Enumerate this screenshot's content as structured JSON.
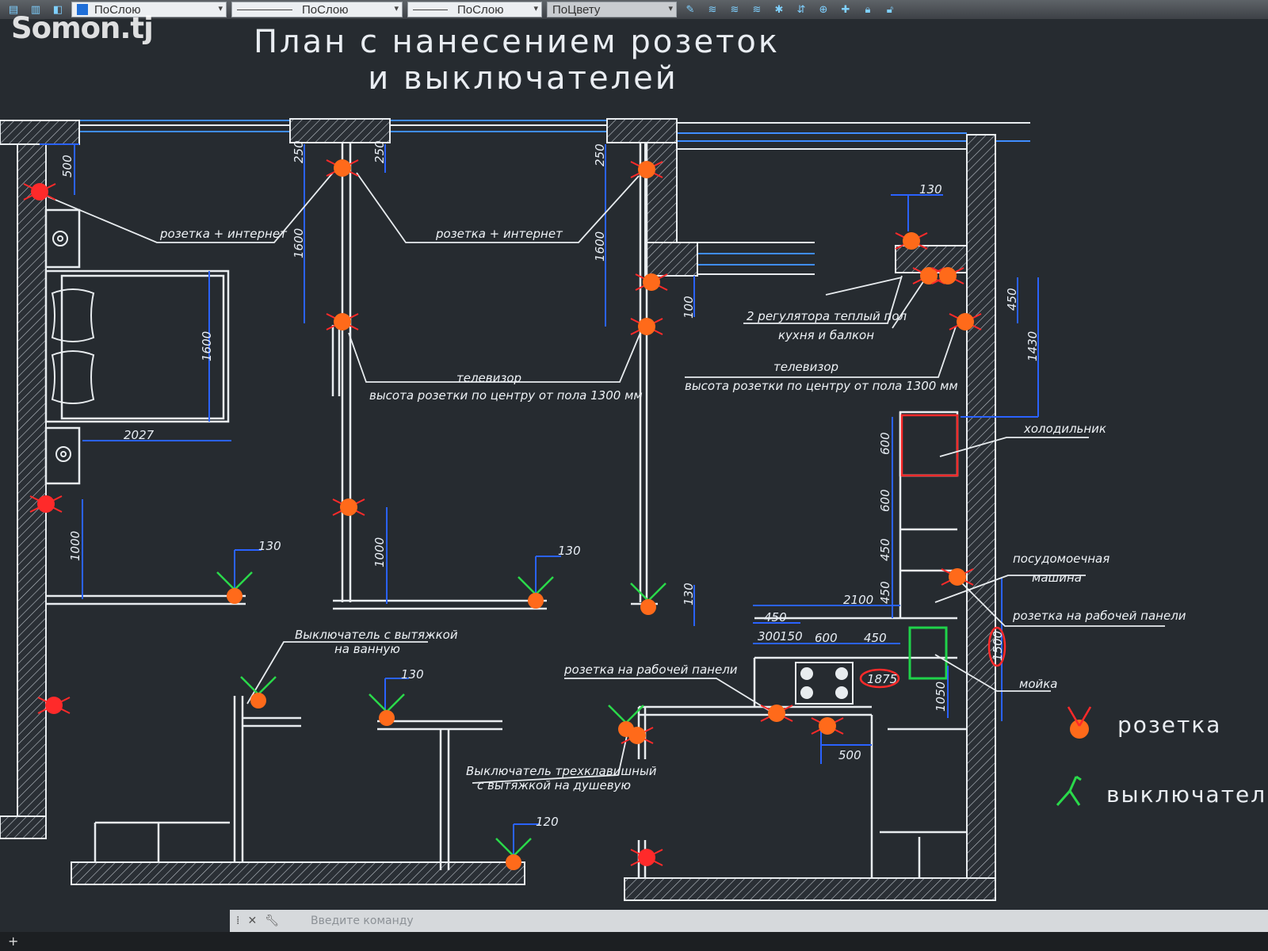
{
  "watermark": "Somon.tj",
  "toolbar": {
    "layer_select": "ПоСлою",
    "linetype_select": "ПоСлою",
    "lineweight_select": "ПоСлою",
    "color_select": "ПоЦвету",
    "layer_swatch_color": "#1f6fd8"
  },
  "drawing": {
    "title_line1": "План с нанесением розеток",
    "title_line2": "и выключателей",
    "labels": {
      "socket_internet_1": "розетка + интернет",
      "socket_internet_2": "розетка + интернет",
      "tv_1": "телевизор",
      "tv_height_1": "высота розетки по центру от пола 1300 мм",
      "tv_2": "телевизор",
      "tv_height_2": "высота розетки по центру от пола 1300 мм",
      "floor_regulators_1": "2 регулятора теплый пол",
      "floor_regulators_2": "кухня и балкон",
      "fridge": "холодильник",
      "dishwasher_1": "посудомоечная",
      "dishwasher_2": "машина",
      "work_panel_socket_right": "розетка на рабочей панели",
      "work_panel_socket_left": "розетка на рабочей панели",
      "sink": "мойка",
      "bath_switch_1": "Выключатель с вытяжкой",
      "bath_switch_2": "на ванную",
      "triple_switch_1": "Выключатель трехклавишный",
      "triple_switch_2": "с вытяжкой на душевую"
    },
    "dimensions": {
      "d500_top": "500",
      "d250_a": "250",
      "d250_b": "250",
      "d250_c": "250",
      "d1600_a": "1600",
      "d1600_b": "1600",
      "d1600_bed": "1600",
      "d2027": "2027",
      "d100": "100",
      "d130_top": "130",
      "d450_right": "450",
      "d1430": "1430",
      "d600_a": "600",
      "d600_b": "600",
      "d450_a": "450",
      "d450_b": "450",
      "d2100": "2100",
      "d450_c": "450",
      "d300": "300",
      "d150": "150",
      "d600_c": "600",
      "d450_d": "450",
      "d1875": "1875",
      "d1050": "1050",
      "d1500": "1500",
      "d500_bottom": "500",
      "d1000_a": "1000",
      "d1000_b": "1000",
      "d130_a": "130",
      "d130_b": "130",
      "d130_c": "130",
      "d130_d": "130",
      "d120": "120"
    },
    "legend": {
      "socket": "розетка",
      "switch": "выключател"
    },
    "colors": {
      "wall": "#e8ecef",
      "dimension": "#1f5fff",
      "socket_fill": "#ff6a1a",
      "socket_red": "#ff2a2a",
      "switch_green": "#2ad94a",
      "fridge_outline": "#ff2a2a",
      "sink_outline": "#1fd34a"
    }
  },
  "command_line": {
    "placeholder": "Введите команду"
  }
}
